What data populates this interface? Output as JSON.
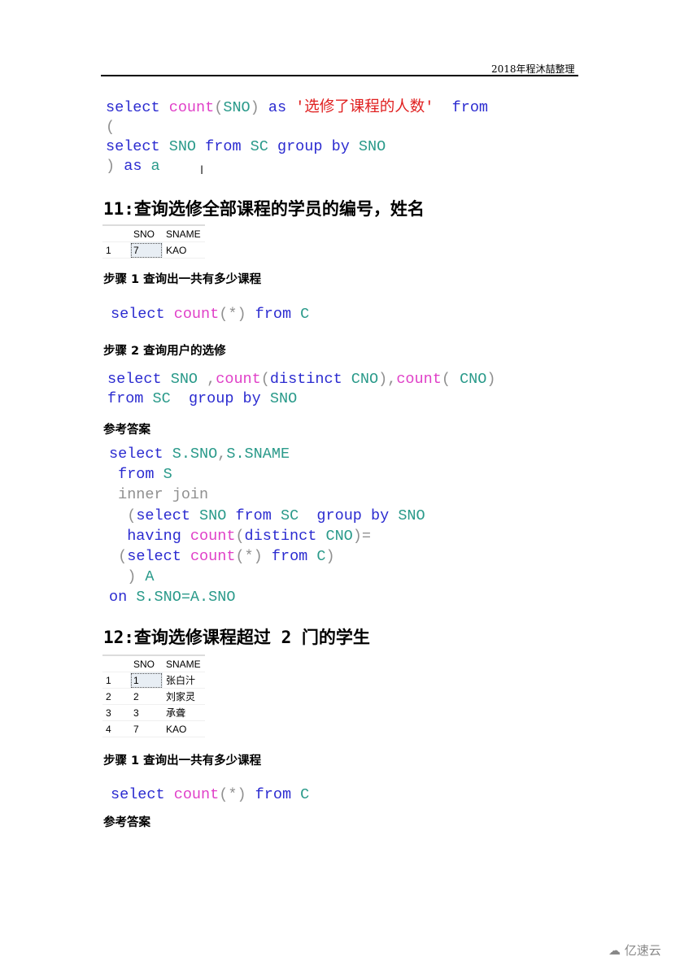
{
  "header": {
    "text": "2018年程沐喆整理"
  },
  "block1": {
    "lines": [
      [
        [
          "kw",
          "select "
        ],
        [
          "fn",
          "count"
        ],
        [
          "op",
          "("
        ],
        [
          "id",
          "SNO"
        ],
        [
          "op",
          ")"
        ],
        [
          "kw",
          " as "
        ],
        [
          "str",
          "'选修了课程的人数'"
        ],
        [
          "kw",
          "  from"
        ]
      ],
      [
        [
          "op",
          "("
        ]
      ],
      [
        [
          "kw",
          "select "
        ],
        [
          "id",
          "SNO"
        ],
        [
          "kw",
          " from "
        ],
        [
          "id",
          "SC"
        ],
        [
          "kw",
          " group by "
        ],
        [
          "id",
          "SNO"
        ]
      ],
      [
        [
          "op",
          ")"
        ],
        [
          "kw",
          " as "
        ],
        [
          "id",
          "a"
        ]
      ]
    ]
  },
  "section11": {
    "title": "11:查询选修全部课程的学员的编号，姓名",
    "result": {
      "columns": [
        "",
        "SNO",
        "SNAME"
      ],
      "rows": [
        [
          "1",
          "7",
          "KAO"
        ]
      ]
    },
    "step1": {
      "label": "步骤 1  查询出一共有多少课程"
    },
    "step1_code": [
      [
        [
          "kw",
          "select "
        ],
        [
          "fn",
          "count"
        ],
        [
          "op",
          "(*)"
        ],
        [
          "kw",
          " from "
        ],
        [
          "id",
          "C"
        ]
      ]
    ],
    "step2": {
      "label": "步骤 2  查询用户的选修"
    },
    "step2_code": [
      [
        [
          "kw",
          "select "
        ],
        [
          "id",
          "SNO"
        ],
        [
          "op",
          " ,"
        ],
        [
          "fn",
          "count"
        ],
        [
          "op",
          "("
        ],
        [
          "kw",
          "distinct "
        ],
        [
          "id",
          "CNO"
        ],
        [
          "op",
          "),"
        ],
        [
          "fn",
          "count"
        ],
        [
          "op",
          "( "
        ],
        [
          "id",
          "CNO"
        ],
        [
          "op",
          ")"
        ]
      ],
      [
        [
          "kw",
          "from "
        ],
        [
          "id",
          "SC"
        ],
        [
          "kw",
          "  group by "
        ],
        [
          "id",
          "SNO"
        ]
      ]
    ],
    "answer": {
      "label": "参考答案"
    },
    "answer_code": [
      [
        [
          "kw",
          "select "
        ],
        [
          "id",
          "S.SNO"
        ],
        [
          "op",
          ","
        ],
        [
          "id",
          "S.SNAME"
        ]
      ],
      [
        [
          "kw",
          " from "
        ],
        [
          "id",
          "S"
        ]
      ],
      [
        [
          "op",
          " inner join"
        ]
      ],
      [
        [
          "op",
          "  ("
        ],
        [
          "kw",
          "select "
        ],
        [
          "id",
          "SNO"
        ],
        [
          "kw",
          " from "
        ],
        [
          "id",
          "SC"
        ],
        [
          "kw",
          "  group by "
        ],
        [
          "id",
          "SNO"
        ]
      ],
      [
        [
          "kw",
          "  having "
        ],
        [
          "fn",
          "count"
        ],
        [
          "op",
          "("
        ],
        [
          "kw",
          "distinct "
        ],
        [
          "id",
          "CNO"
        ],
        [
          "op",
          ")="
        ]
      ],
      [
        [
          "op",
          " ("
        ],
        [
          "kw",
          "select "
        ],
        [
          "fn",
          "count"
        ],
        [
          "op",
          "(*)"
        ],
        [
          "kw",
          " from "
        ],
        [
          "id",
          "C"
        ],
        [
          "op",
          ")"
        ]
      ],
      [
        [
          "op",
          "  ) "
        ],
        [
          "id",
          "A"
        ]
      ],
      [
        [
          "kw",
          "on "
        ],
        [
          "id",
          "S.SNO=A.SNO"
        ]
      ]
    ]
  },
  "section12": {
    "title": "12:查询选修课程超过 2 门的学生",
    "result": {
      "columns": [
        "",
        "SNO",
        "SNAME"
      ],
      "rows": [
        [
          "1",
          "1",
          "张白汁"
        ],
        [
          "2",
          "2",
          "刘家灵"
        ],
        [
          "3",
          "3",
          "承聋"
        ],
        [
          "4",
          "7",
          "KAO"
        ]
      ]
    },
    "step1": {
      "label": "步骤 1  查询出一共有多少课程"
    },
    "step1_code": [
      [
        [
          "kw",
          "select "
        ],
        [
          "fn",
          "count"
        ],
        [
          "op",
          "(*)"
        ],
        [
          "kw",
          " from "
        ],
        [
          "id",
          "C"
        ]
      ]
    ],
    "answer": {
      "label": "参考答案"
    }
  },
  "watermark": {
    "text": "亿速云"
  }
}
